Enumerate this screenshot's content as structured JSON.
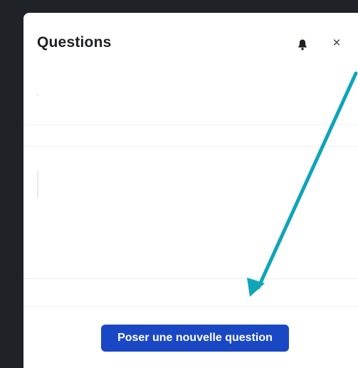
{
  "panel": {
    "title": "Questions",
    "bell_icon": "bell-icon",
    "close_label": "×",
    "ask_button_label": "Poser une nouvelle question"
  },
  "annotation": {
    "arrow_color": "#0ea5b7"
  },
  "colors": {
    "background": "#1f2226",
    "panel": "#ffffff",
    "button": "#1a48c4"
  }
}
